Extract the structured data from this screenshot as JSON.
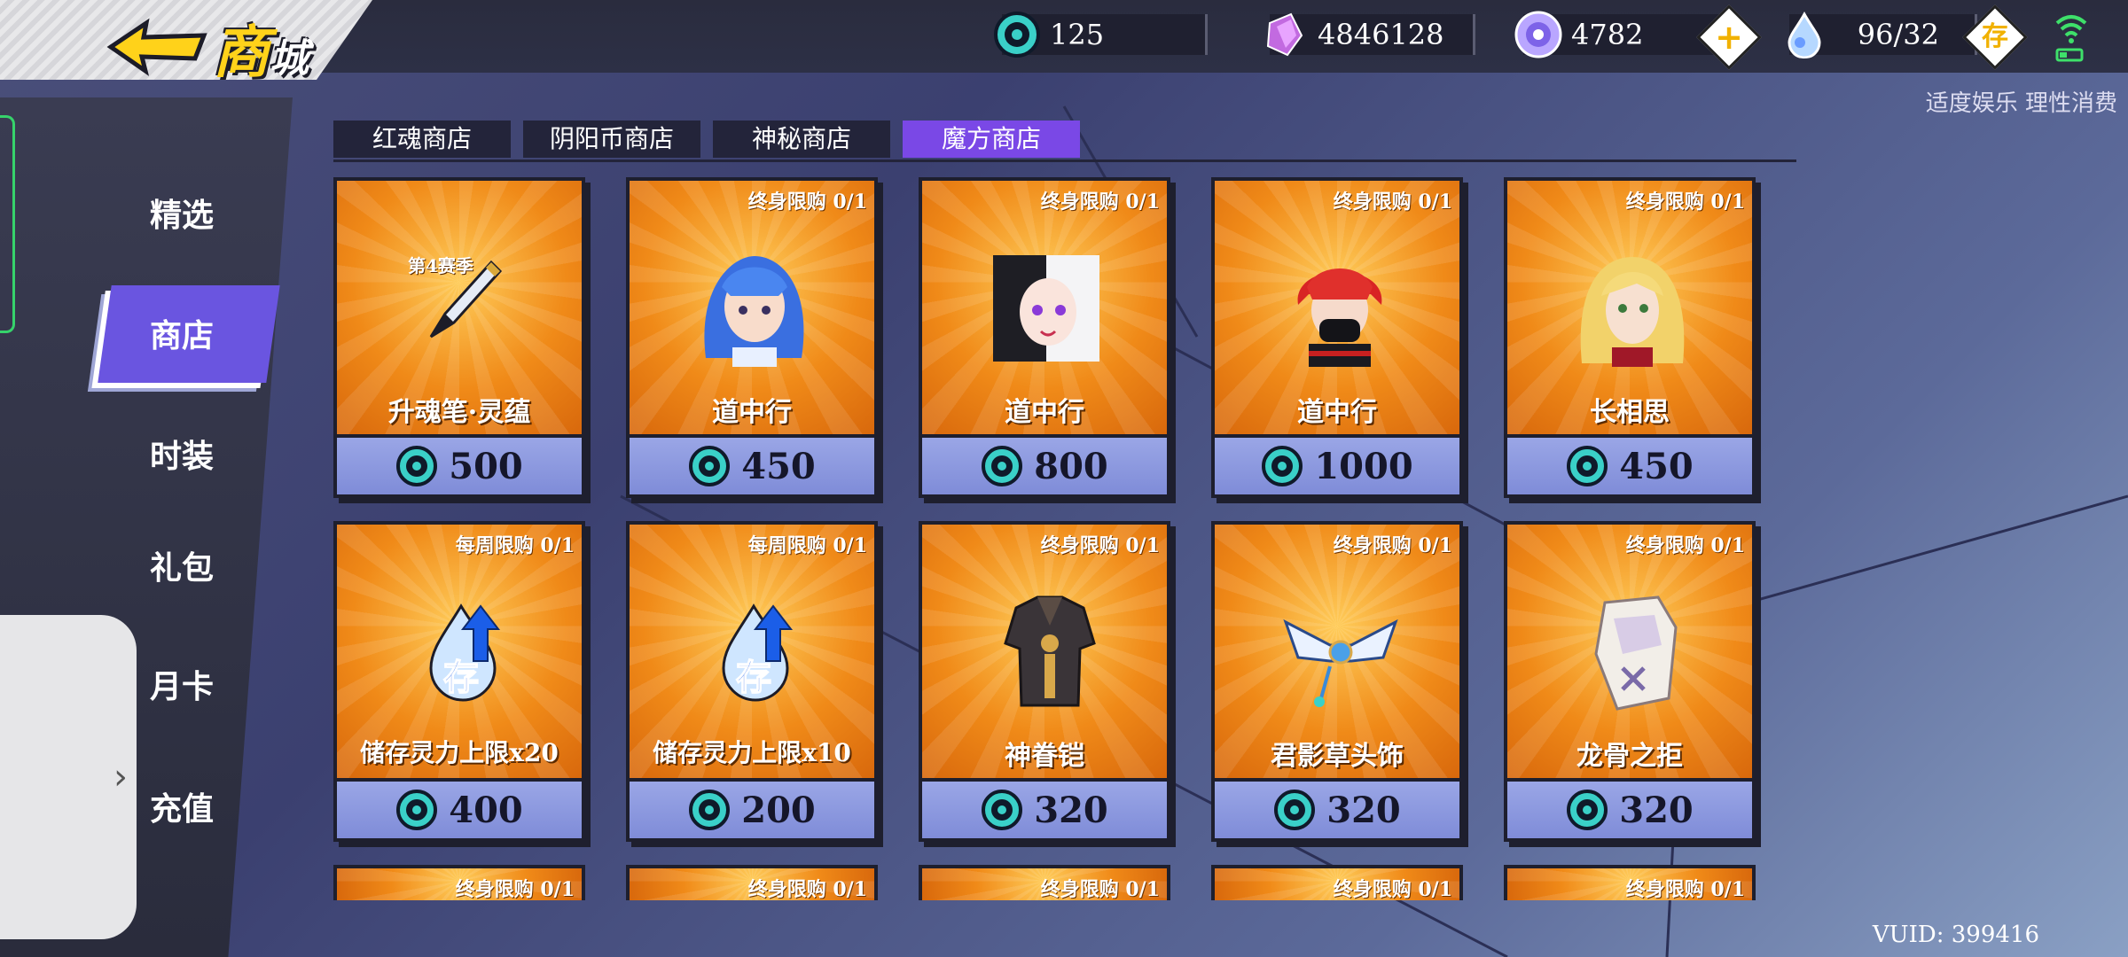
{
  "header": {
    "title_main": "商",
    "title_sub": "城",
    "resources": [
      {
        "name": "soul-coin",
        "value": "125"
      },
      {
        "name": "crystal",
        "value": "4846128"
      },
      {
        "name": "orb",
        "value": "4782"
      },
      {
        "name": "spirit-drop",
        "value": "96/32"
      }
    ],
    "plus_label": "+",
    "store_label": "存",
    "notice": "适度娱乐 理性消费"
  },
  "sidebar": {
    "items": [
      {
        "label": "精选"
      },
      {
        "label": "商店"
      },
      {
        "label": "时装"
      },
      {
        "label": "礼包"
      },
      {
        "label": "月卡"
      },
      {
        "label": "充值"
      }
    ],
    "active": "商店"
  },
  "tabs": [
    {
      "label": "红魂商店"
    },
    {
      "label": "阴阳币商店"
    },
    {
      "label": "神秘商店"
    },
    {
      "label": "魔方商店"
    }
  ],
  "cards": [
    {
      "name": "升魂笔·灵蕴",
      "price": "500",
      "limit": "",
      "badge": "第4赛季",
      "icon": "brush-icon"
    },
    {
      "name": "道中行",
      "price": "450",
      "limit": "终身限购 0/1",
      "icon": "portrait-blue-hair-icon"
    },
    {
      "name": "道中行",
      "price": "800",
      "limit": "终身限购 0/1",
      "icon": "portrait-black-white-hair-icon"
    },
    {
      "name": "道中行",
      "price": "1000",
      "limit": "终身限购 0/1",
      "icon": "portrait-red-hair-icon"
    },
    {
      "name": "长相思",
      "price": "450",
      "limit": "终身限购 0/1",
      "icon": "portrait-blonde-icon"
    },
    {
      "name": "储存灵力上限x20",
      "price": "400",
      "limit": "每周限购 0/1",
      "icon": "spirit-storage-icon"
    },
    {
      "name": "储存灵力上限x10",
      "price": "200",
      "limit": "每周限购 0/1",
      "icon": "spirit-storage-icon"
    },
    {
      "name": "神眷铠",
      "price": "320",
      "limit": "终身限购 0/1",
      "icon": "armor-icon"
    },
    {
      "name": "君影草头饰",
      "price": "320",
      "limit": "终身限购 0/1",
      "icon": "headdress-icon"
    },
    {
      "name": "龙骨之拒",
      "price": "320",
      "limit": "终身限购 0/1",
      "icon": "shield-icon"
    }
  ],
  "partial_cards": [
    {
      "limit": "终身限购 0/1"
    },
    {
      "limit": "终身限购 0/1"
    },
    {
      "limit": "终身限购 0/1"
    },
    {
      "limit": "终身限购 0/1"
    },
    {
      "limit": "终身限购 0/1"
    }
  ],
  "footer": {
    "vuid": "VUID: 399416"
  },
  "colors": {
    "accent": "#7a48e6",
    "gold": "#ffd21a",
    "card_orange": "#f08a18",
    "price_bar": "#8f9be0"
  }
}
